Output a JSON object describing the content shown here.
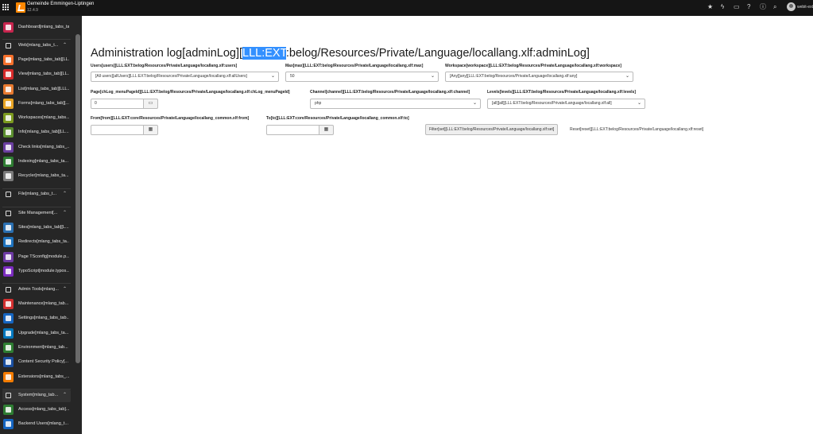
{
  "topbar": {
    "site_name": "Gemeinde Emmingen-Liptingen",
    "version": "12.4.9",
    "user_name": "webit-ext",
    "icons": [
      "star-icon",
      "bolt-icon",
      "document-icon",
      "help-icon",
      "info-icon",
      "search-icon"
    ]
  },
  "sidebar": {
    "items": [
      {
        "label": "Dashboard[mlang_tabs_tab]",
        "icon": "dashboard-icon",
        "color": "#c7254e",
        "group": false
      },
      {
        "label": "Web[mlang_tabs_t...",
        "icon": "web-icon",
        "color": "",
        "group": true
      },
      {
        "label": "Page[mlang_tabs_tab][LL...",
        "icon": "page-icon",
        "color": "#f7712c",
        "group": false
      },
      {
        "label": "View[mlang_tabs_tab][LL...",
        "icon": "view-icon",
        "color": "#d72a2a",
        "group": false
      },
      {
        "label": "List[mlang_tabs_tab][LLL...",
        "icon": "list-icon",
        "color": "#e87a30",
        "group": false
      },
      {
        "label": "Forms[mlang_tabs_tab][...",
        "icon": "forms-icon",
        "color": "#e8a424",
        "group": false
      },
      {
        "label": "Workspaces[mlang_tabs...",
        "icon": "workspaces-icon",
        "color": "#7c9a1f",
        "group": false
      },
      {
        "label": "Info[mlang_tabs_tab][LL...",
        "icon": "info-module-icon",
        "color": "#5b8f2f",
        "group": false
      },
      {
        "label": "Check links[mlang_tabs_...",
        "icon": "check-links-icon",
        "color": "#6b3fa0",
        "group": false
      },
      {
        "label": "Indexing[mlang_tabs_ta...",
        "icon": "indexing-icon",
        "color": "#2e7d32",
        "group": false
      },
      {
        "label": "Recycler[mlang_tabs_ta...",
        "icon": "recycler-icon",
        "color": "#7a7a7a",
        "group": false
      },
      {
        "label": "File[mlang_tabs_t...",
        "icon": "file-icon",
        "color": "",
        "group": true
      },
      {
        "label": "Site Management[...",
        "icon": "site-management-icon",
        "color": "",
        "group": true
      },
      {
        "label": "Sites[mlang_tabs_tab][L...",
        "icon": "sites-icon",
        "color": "#2a6fb0",
        "group": false
      },
      {
        "label": "Redirects[mlang_tabs_ta...",
        "icon": "redirects-icon",
        "color": "#1e73be",
        "group": false
      },
      {
        "label": "Page TSconfig[module.p...",
        "icon": "tsconfig-icon",
        "color": "#6d3aa3",
        "group": false
      },
      {
        "label": "TypoScript[module.typos...",
        "icon": "typoscript-icon",
        "color": "#7b2cbf",
        "group": false
      },
      {
        "label": "Admin Tools[mlang...",
        "icon": "admin-tools-icon",
        "color": "",
        "group": true
      },
      {
        "label": "Maintenance[mlang_tab...",
        "icon": "maintenance-icon",
        "color": "#d32f2f",
        "group": false
      },
      {
        "label": "Settings[mlang_tabs_tab...",
        "icon": "settings-icon",
        "color": "#1565c0",
        "group": false
      },
      {
        "label": "Upgrade[mlang_tabs_ta...",
        "icon": "upgrade-icon",
        "color": "#0277bd",
        "group": false
      },
      {
        "label": "Environment[mlang_tab...",
        "icon": "environment-icon",
        "color": "#2e7d32",
        "group": false
      },
      {
        "label": "Content Security Policy[...",
        "icon": "csp-icon",
        "color": "#1a4fa0",
        "group": false
      },
      {
        "label": "Extensions[mlang_tabs_...",
        "icon": "extensions-icon",
        "color": "#f57c00",
        "group": false
      },
      {
        "label": "System[mlang_tab...",
        "icon": "system-icon",
        "color": "",
        "group": true
      },
      {
        "label": "Access[mlang_tabs_tab]...",
        "icon": "access-icon",
        "color": "#2e7d32",
        "group": false
      },
      {
        "label": "Backend Users[mlang_t...",
        "icon": "backend-users-icon",
        "color": "#1565c0",
        "group": false
      }
    ]
  },
  "main": {
    "title_pre": "Administration log[adminLog][",
    "title_sel": "LLL:EXT",
    "title_post": ":belog/Resources/Private/Language/locallang.xlf:adminLog]",
    "users_label": "Users[users][LLL:EXT:belog/Resources/Private/Language/locallang.xlf:users]",
    "users_value": "[All users][allUsers][LLL:EXT:belog/Resources/Private/Language/locallang.xlf:allUsers]",
    "max_label": "Max[max][LLL:EXT:belog/Resources/Private/Language/locallang.xlf:max]",
    "max_value": "50",
    "workspace_label": "Workspace[workspace][LLL:EXT:belog/Resources/Private/Language/locallang.xlf:workspace]",
    "workspace_value": "[Any][any][LLL:EXT:belog/Resources/Private/Language/locallang.xlf:any]",
    "page_label": "Page[chLog_menuPageId][LLL:EXT:belog/Resources/Private/Language/locallang.xlf:chLog_menuPageId]",
    "page_value": "0",
    "channel_label": "Channel[channel][LLL:EXT:belog/Resources/Private/Language/locallang.xlf:channel]",
    "channel_value": "php",
    "levels_label": "Levels[levels][LLL:EXT:belog/Resources/Private/Language/locallang.xlf:levels]",
    "levels_value": "[all][all][LLL:EXT:belog/Resources/Private/Language/locallang.xlf:all]",
    "from_label": "From[from][LLL:EXT:core/Resources/Private/Language/locallang_common.xlf:from]",
    "to_label": "To[to][LLL:EXT:core/Resources/Private/Language/locallang_common.xlf:to]",
    "filter_label": "Filter[set][LLL:EXT:belog/Resources/Private/Language/locallang.xlf:set]",
    "reset_label": "Reset[reset][LLL:EXT:belog/Resources/Private/Language/locallang.xlf:reset]"
  }
}
